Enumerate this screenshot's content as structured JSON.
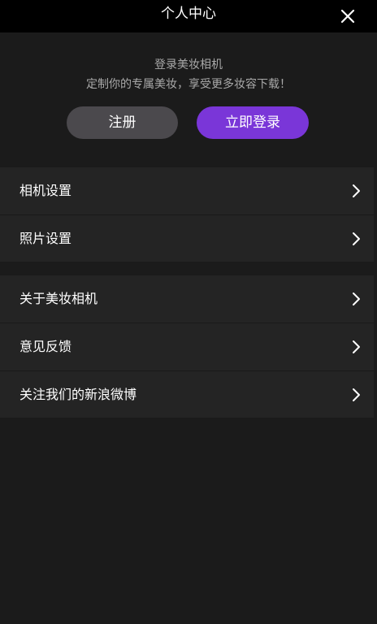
{
  "header": {
    "title": "个人中心",
    "close_icon": "close-icon"
  },
  "login_panel": {
    "title": "登录美妆相机",
    "subtitle": "定制你的专属美妆，享受更多妆容下载！",
    "register_label": "注册",
    "login_label": "立即登录"
  },
  "settings": {
    "items": [
      {
        "label": "相机设置",
        "icon": "chevron-right-icon"
      },
      {
        "label": "照片设置",
        "icon": "chevron-right-icon"
      }
    ]
  },
  "about": {
    "items": [
      {
        "label": "关于美妆相机",
        "icon": "chevron-right-icon"
      },
      {
        "label": "意见反馈",
        "icon": "chevron-right-icon"
      },
      {
        "label": "关注我们的新浪微博",
        "icon": "chevron-right-icon"
      }
    ]
  },
  "colors": {
    "accent": "#7a36d8",
    "secondary_button": "#4b494d",
    "background": "#1b1b1b",
    "list_background": "#242424",
    "header_background": "#000000"
  }
}
